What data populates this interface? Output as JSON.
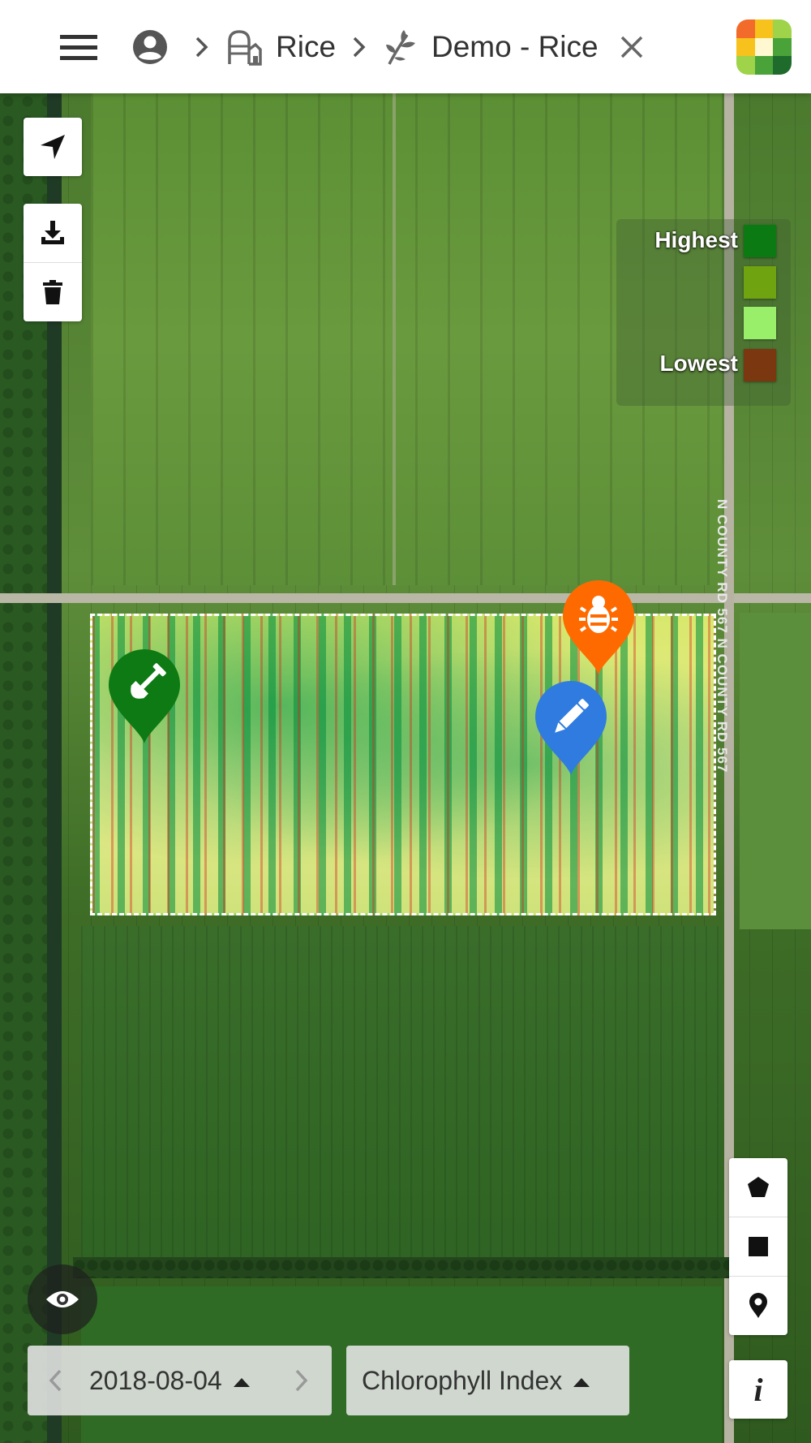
{
  "header": {
    "farm_label": "Rice",
    "field_label": "Demo - Rice"
  },
  "map": {
    "road_label": "N COUNTY RD 567 N COUNTY RD 567"
  },
  "legend": {
    "highest_label": "Highest",
    "lowest_label": "Lowest",
    "colors": [
      "#0b7a12",
      "#6fa30f",
      "#99ef6a",
      "#7a3710"
    ]
  },
  "markers": {
    "soil_color": "#0e7a14",
    "pest_color": "#ff6a00",
    "note_color": "#2f7be0"
  },
  "bottom": {
    "date_value": "2018-08-04",
    "index_value": "Chlorophyll Index"
  },
  "icons": {
    "menu": "menu-icon",
    "user": "account-circle-icon",
    "farm": "silo-barn-icon",
    "field": "plant-icon",
    "close": "close-icon",
    "logo": "app-logo",
    "locate": "navigation-arrow-icon",
    "download": "download-icon",
    "delete": "trash-icon",
    "polygon": "pentagon-icon",
    "rectangle": "square-icon",
    "pin": "map-pin-icon",
    "visibility": "eye-icon",
    "info": "info-icon"
  }
}
